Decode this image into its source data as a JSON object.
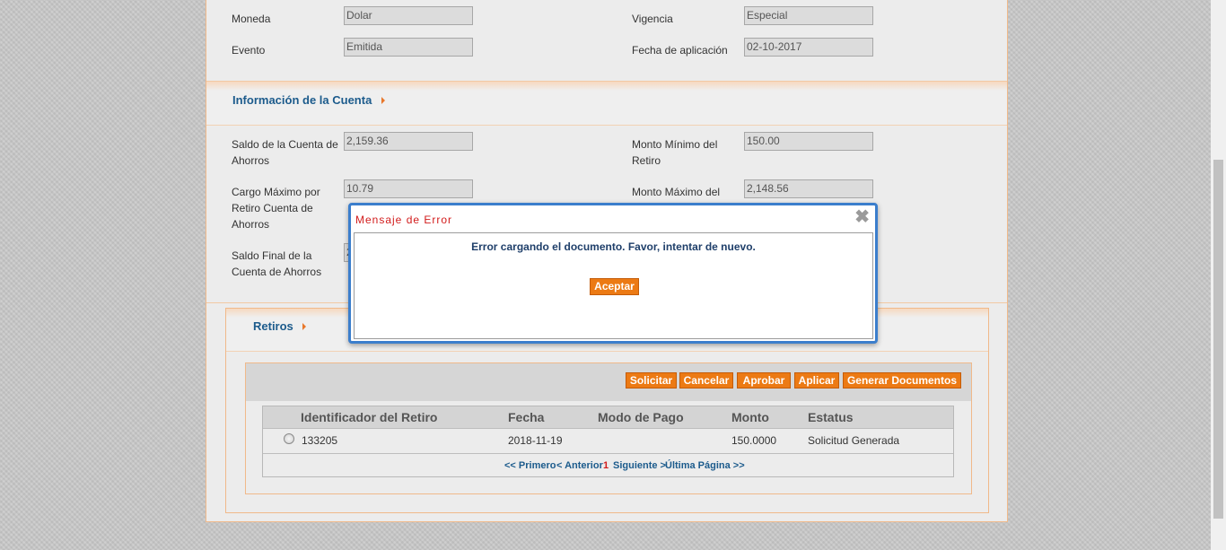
{
  "top_fields": {
    "moneda_label": "Moneda",
    "moneda_value": "Dolar",
    "evento_label": "Evento",
    "evento_value": "Emitida",
    "vigencia_label": "Vigencia",
    "vigencia_value": "Especial",
    "fecha_aplicacion_label": "Fecha de aplicación",
    "fecha_aplicacion_value": "02-10-2017"
  },
  "cuenta": {
    "title": "Información de la Cuenta",
    "saldo_label_1": "Saldo de la Cuenta de",
    "saldo_label_2": "Ahorros",
    "saldo_value": "2,159.36",
    "cargo_label_1": "Cargo Máximo por",
    "cargo_label_2": "Retiro Cuenta de",
    "cargo_label_3": "Ahorros",
    "cargo_value": "10.79",
    "saldo_final_label_1": "Saldo Final de la",
    "saldo_final_label_2": "Cuenta de Ahorros",
    "saldo_final_value": "2",
    "monto_minimo_label_1": "Monto Mínimo del",
    "monto_minimo_label_2": "Retiro",
    "monto_minimo_value": "150.00",
    "monto_maximo_label_1": "Monto Máximo del",
    "monto_maximo_value": "2,148.56"
  },
  "retiros": {
    "title": "Retiros",
    "buttons": {
      "solicitar": "Solicitar",
      "cancelar": "Cancelar",
      "aprobar": "Aprobar",
      "aplicar": "Aplicar",
      "generar": "Generar Documentos"
    },
    "columns": [
      "Identificador del Retiro",
      "Fecha",
      "Modo de Pago",
      "Monto",
      "Estatus"
    ],
    "rows": [
      {
        "id": "133205",
        "fecha": "2018-11-19",
        "modo": "",
        "monto": "150.0000",
        "estatus": "Solicitud Generada"
      }
    ],
    "pager": {
      "first": "<< Primero",
      "prev": "< Anterior",
      "current": "1",
      "next": "Siguiente >",
      "last": "Última Página >>"
    }
  },
  "dialog": {
    "title": "Mensaje de Error",
    "message": "Error cargando el documento. Favor, intentar de nuevo.",
    "accept": "Aceptar",
    "close_icon": "close-icon"
  }
}
